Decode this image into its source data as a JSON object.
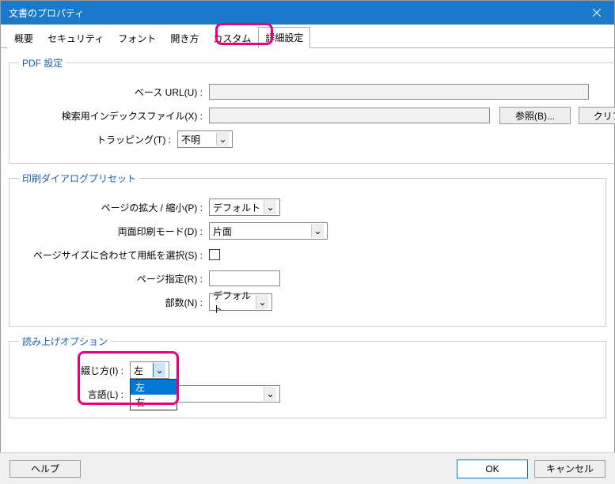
{
  "window": {
    "title": "文書のプロパティ"
  },
  "tabs": {
    "summary": "概要",
    "security": "セキュリティ",
    "fonts": "フォント",
    "initial": "開き方",
    "custom": "カスタム",
    "advanced": "詳細設定"
  },
  "pdf": {
    "legend": "PDF 設定",
    "baseurl_label": "ベース URL(U) :",
    "baseurl_value": "",
    "index_label": "検索用インデックスファイル(X) :",
    "index_value": "",
    "browse": "参照(B)...",
    "clear": "クリア(C)",
    "trapping_label": "トラッピング(T) :",
    "trapping_value": "不明"
  },
  "print": {
    "legend": "印刷ダイアログプリセット",
    "scale_label": "ページの拡大 / 縮小(P) :",
    "scale_value": "デフォルト",
    "duplex_label": "両面印刷モード(D) :",
    "duplex_value": "片面",
    "autofit_label": "ページサイズに合わせて用紙を選択(S) :",
    "range_label": "ページ指定(R) :",
    "range_value": "",
    "copies_label": "部数(N) :",
    "copies_value": "デフォルト"
  },
  "read": {
    "legend": "読み上げオプション",
    "binding_label": "綴じ方(I) :",
    "binding_value": "左",
    "binding_options": {
      "left": "左",
      "right": "右"
    },
    "lang_label": "言語(L) :",
    "lang_value": ""
  },
  "buttons": {
    "help": "ヘルプ",
    "ok": "OK",
    "cancel": "キャンセル"
  }
}
